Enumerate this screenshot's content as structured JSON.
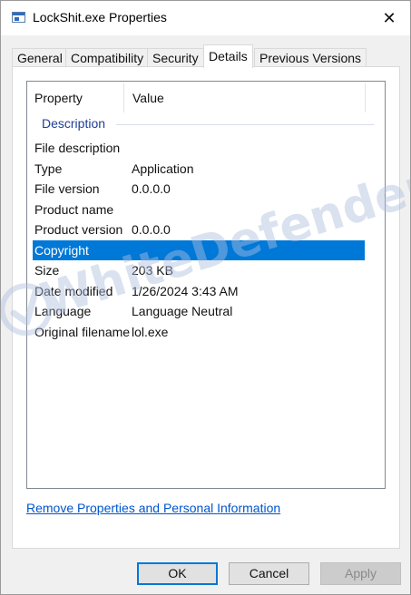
{
  "window": {
    "title": "LockShit.exe Properties",
    "close_glyph": "✕"
  },
  "tabs": [
    {
      "label": "General"
    },
    {
      "label": "Compatibility"
    },
    {
      "label": "Security"
    },
    {
      "label": "Details",
      "active": true
    },
    {
      "label": "Previous Versions"
    }
  ],
  "details": {
    "columns": {
      "property": "Property",
      "value": "Value"
    },
    "group": "Description",
    "rows": [
      {
        "property": "File description",
        "value": ""
      },
      {
        "property": "Type",
        "value": "Application"
      },
      {
        "property": "File version",
        "value": "0.0.0.0"
      },
      {
        "property": "Product name",
        "value": ""
      },
      {
        "property": "Product version",
        "value": "0.0.0.0"
      },
      {
        "property": "Copyright",
        "value": "",
        "selected": true
      },
      {
        "property": "Size",
        "value": "203 KB"
      },
      {
        "property": "Date modified",
        "value": "1/26/2024 3:43 AM"
      },
      {
        "property": "Language",
        "value": "Language Neutral"
      },
      {
        "property": "Original filename",
        "value": "lol.exe"
      }
    ]
  },
  "remove_link": "Remove Properties and Personal Information",
  "buttons": {
    "ok": "OK",
    "cancel": "Cancel",
    "apply": "Apply"
  },
  "watermark": {
    "text": "WhiteDefender"
  },
  "colors": {
    "selection": "#0078d7",
    "group_title": "#1e3e9a",
    "link": "#0055cc"
  }
}
